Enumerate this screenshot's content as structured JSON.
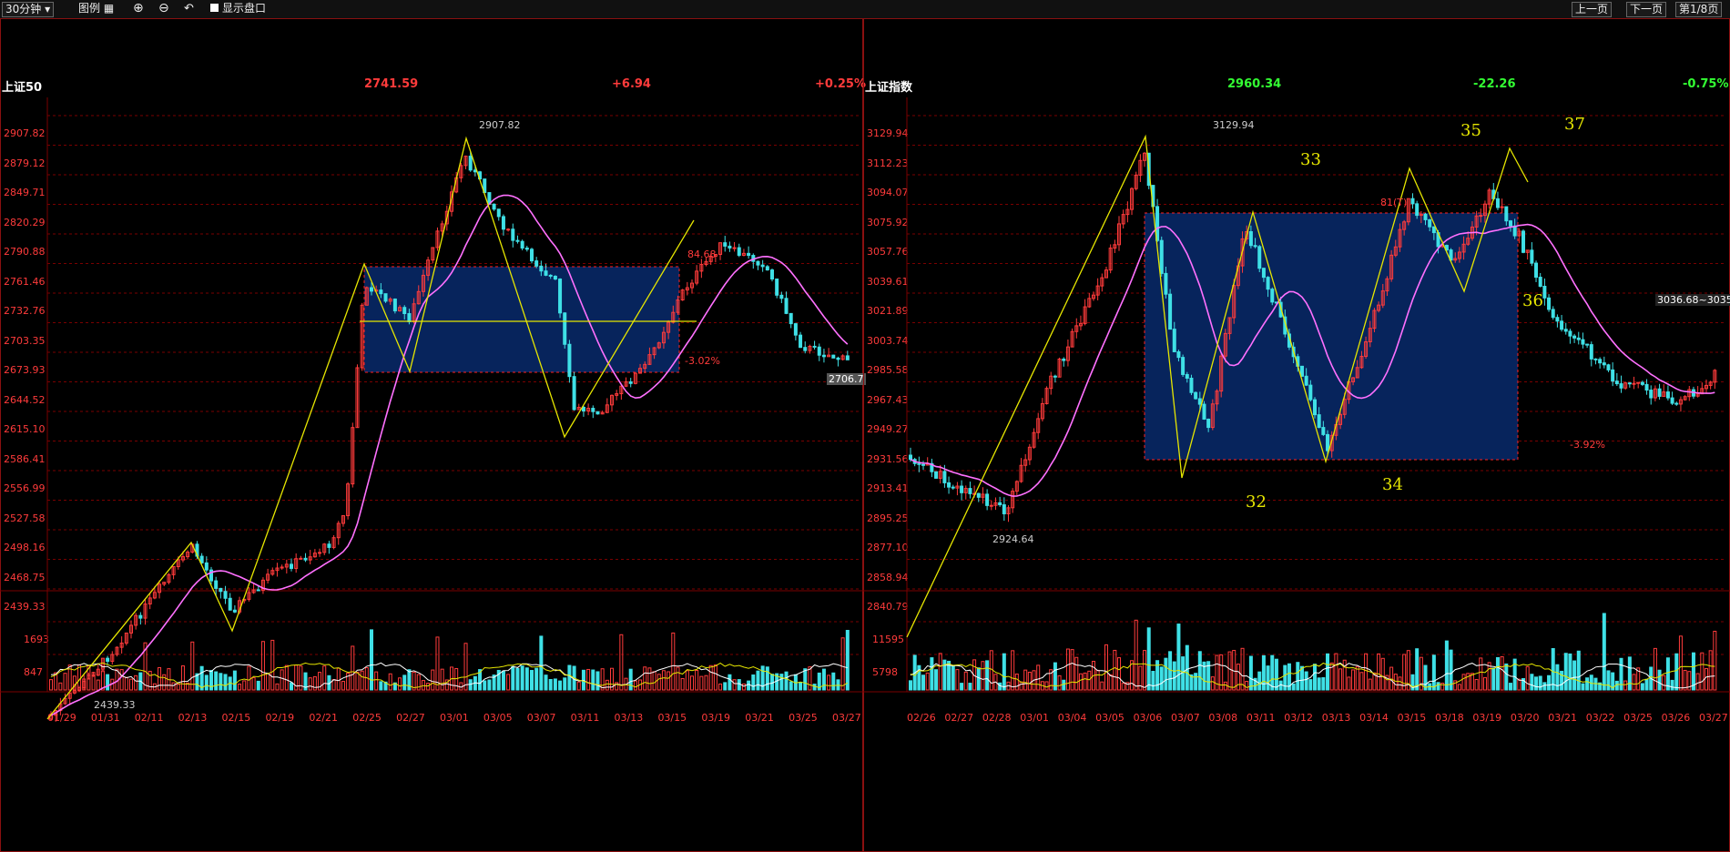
{
  "toolbar": {
    "period": "30分钟",
    "legend_label": "图例",
    "show_orderbook_label": "显示盘口",
    "prev_page": "上一页",
    "next_page": "下一页",
    "page_indicator": "第1/8页"
  },
  "colors": {
    "up": "#ff3b3b",
    "down": "#3fe0e6",
    "ma": "#ff70ff",
    "wave": "#e6e600",
    "box": "#07245c",
    "grid": "#7a0000"
  },
  "left": {
    "name": "上证50",
    "price": "2741.59",
    "change": "+6.94",
    "pct": "+0.25%",
    "price_ticks": [
      "2907.82",
      "2879.12",
      "2849.71",
      "2820.29",
      "2790.88",
      "2761.46",
      "2732.76",
      "2703.35",
      "2673.93",
      "2644.52",
      "2615.10",
      "2586.41",
      "2556.99",
      "2527.58",
      "2498.16",
      "2468.75",
      "2439.33"
    ],
    "vol_ticks": [
      "1693",
      "847"
    ],
    "dates": [
      "01/29",
      "01/31",
      "02/11",
      "02/13",
      "02/15",
      "02/19",
      "02/21",
      "02/25",
      "02/27",
      "03/01",
      "03/05",
      "03/07",
      "03/11",
      "03/13",
      "03/15",
      "03/19",
      "03/21",
      "03/25",
      "03/27"
    ],
    "high_label": "2907.82",
    "low_label": "2439.33",
    "last_label": "2706.7",
    "box_top_pct": "84.68",
    "box_bottom_pct": "-3.02%"
  },
  "right": {
    "name": "上证指数",
    "price": "2960.34",
    "change": "-22.26",
    "pct": "-0.75%",
    "price_ticks": [
      "3129.94",
      "3112.23",
      "3094.07",
      "3075.92",
      "3057.76",
      "3039.61",
      "3021.89",
      "3003.74",
      "2985.58",
      "2967.43",
      "2949.27",
      "2931.56",
      "2913.41",
      "2895.25",
      "2877.10",
      "2858.94",
      "2840.79"
    ],
    "vol_ticks": [
      "11595",
      "5798"
    ],
    "dates": [
      "02/26",
      "02/27",
      "02/28",
      "03/01",
      "03/04",
      "03/05",
      "03/06",
      "03/07",
      "03/08",
      "03/11",
      "03/12",
      "03/13",
      "03/14",
      "03/15",
      "03/18",
      "03/19",
      "03/20",
      "03/21",
      "03/22",
      "03/25",
      "03/26",
      "03/27"
    ],
    "high_label": "3129.94",
    "low_label": "2924.64",
    "last_label": "3036.68~3035.",
    "box_top_pct": "81(T)",
    "box_bottom_pct": "-3.92%",
    "waves": [
      "32",
      "33",
      "34",
      "35",
      "36",
      "37"
    ]
  }
}
